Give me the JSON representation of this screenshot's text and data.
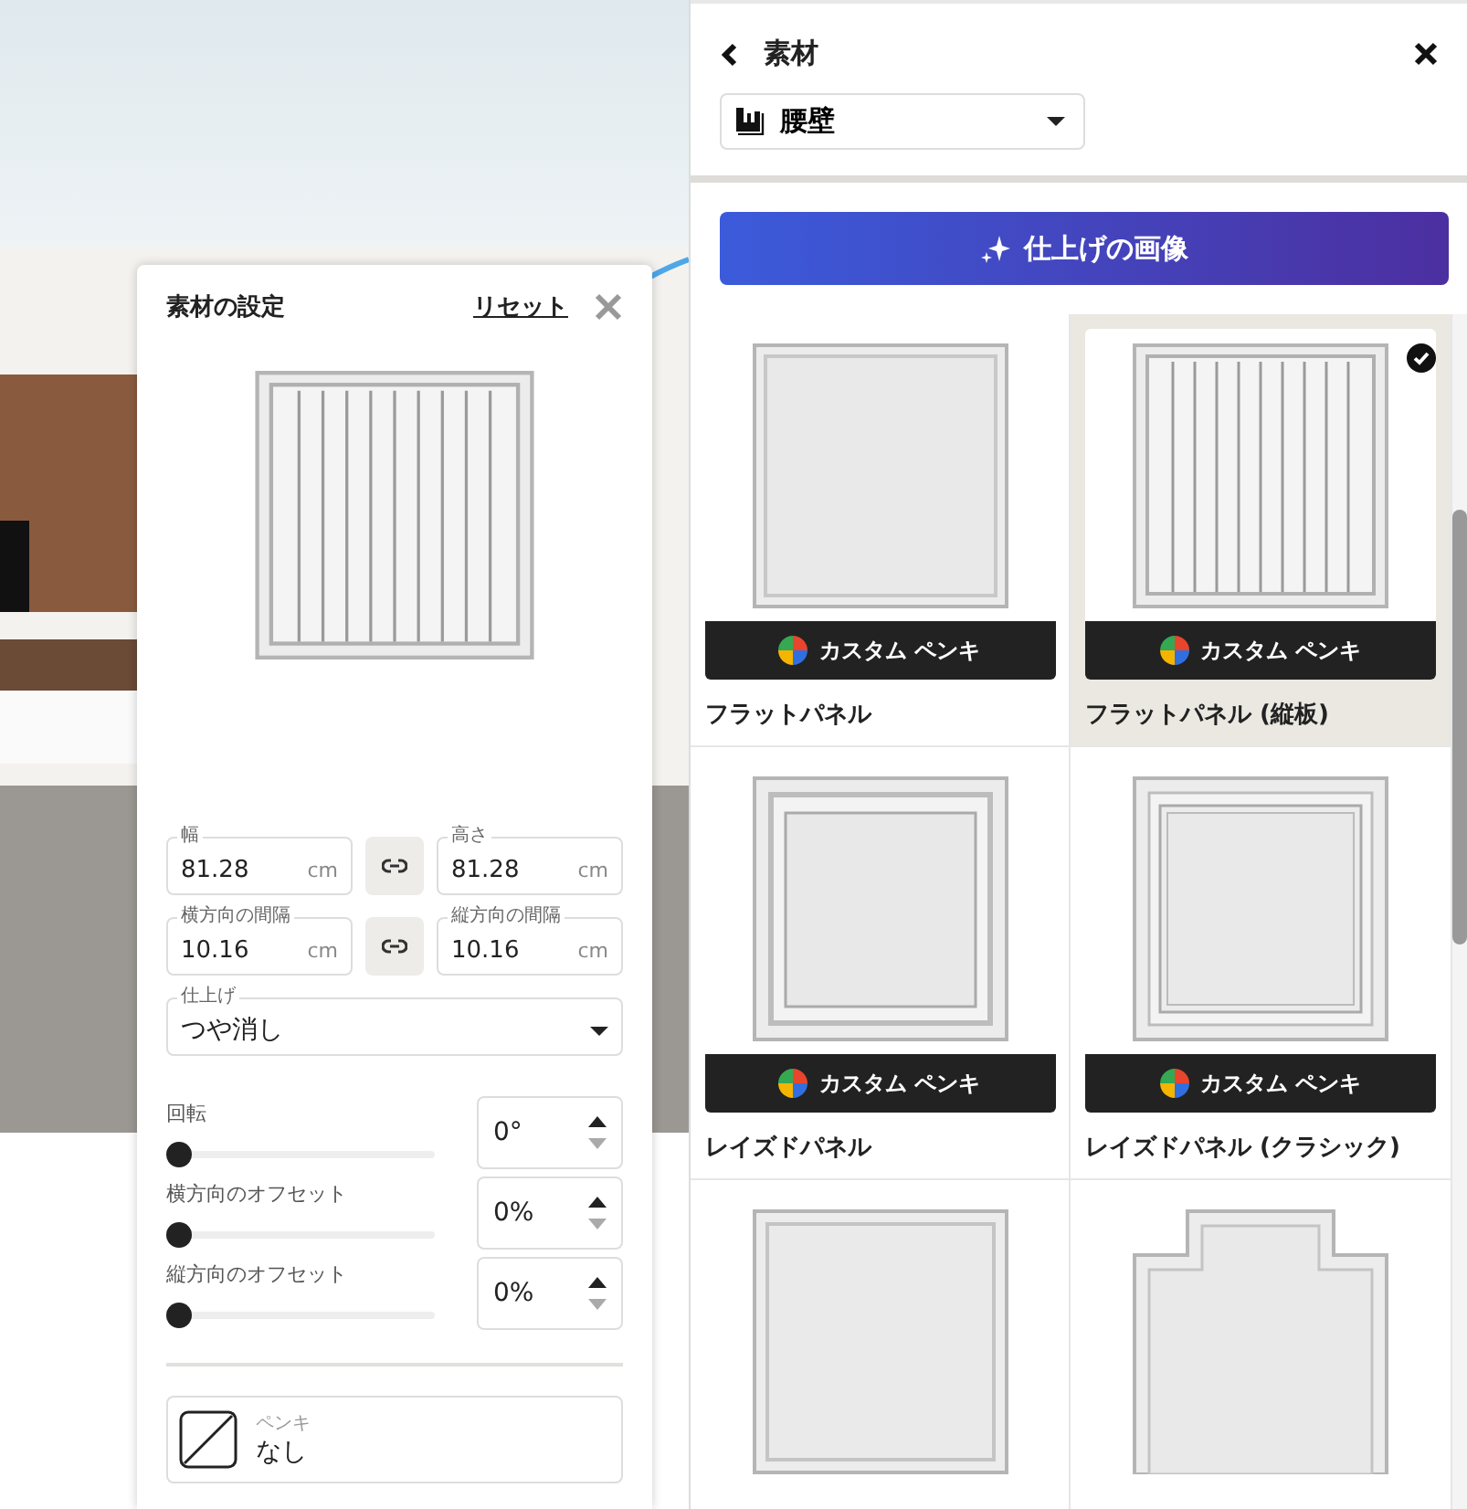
{
  "settings": {
    "title": "素材の設定",
    "reset": "リセット",
    "field_rows": [
      {
        "fields": [
          {
            "label": "幅",
            "value": "81.28",
            "unit": "cm"
          },
          {
            "label": "高さ",
            "value": "81.28",
            "unit": "cm"
          }
        ]
      },
      {
        "fields": [
          {
            "label": "横方向の間隔",
            "value": "10.16",
            "unit": "cm"
          },
          {
            "label": "縦方向の間隔",
            "value": "10.16",
            "unit": "cm"
          }
        ]
      }
    ],
    "finish": {
      "label": "仕上げ",
      "value": "つや消し"
    },
    "sliders": [
      {
        "label": "回転",
        "level": 0,
        "value": "0°",
        "down_disabled": true
      },
      {
        "label": "横方向のオフセット",
        "level": 0,
        "value": "0%",
        "down_disabled": true
      },
      {
        "label": "縦方向のオフセット",
        "level": 0,
        "value": "0%",
        "down_disabled": true
      }
    ],
    "paint": {
      "label": "ペンキ",
      "value": "なし"
    }
  },
  "panel": {
    "title": "素材",
    "category": "腰壁",
    "finish_images_button": "仕上げの画像",
    "materials": [
      {
        "kind": "flat",
        "badge": "カスタム ペンキ",
        "name": "フラットパネル",
        "selected": false
      },
      {
        "kind": "vertical",
        "badge": "カスタム ペンキ",
        "name": "フラットパネル (縦板)",
        "selected": true
      },
      {
        "kind": "raised",
        "badge": "カスタム ペンキ",
        "name": "レイズドパネル",
        "selected": false
      },
      {
        "kind": "classic",
        "badge": "カスタム ペンキ",
        "name": "レイズドパネル (クラシック)",
        "selected": false
      },
      {
        "kind": "bevel",
        "selected": false
      },
      {
        "kind": "cross",
        "selected": false
      }
    ]
  }
}
